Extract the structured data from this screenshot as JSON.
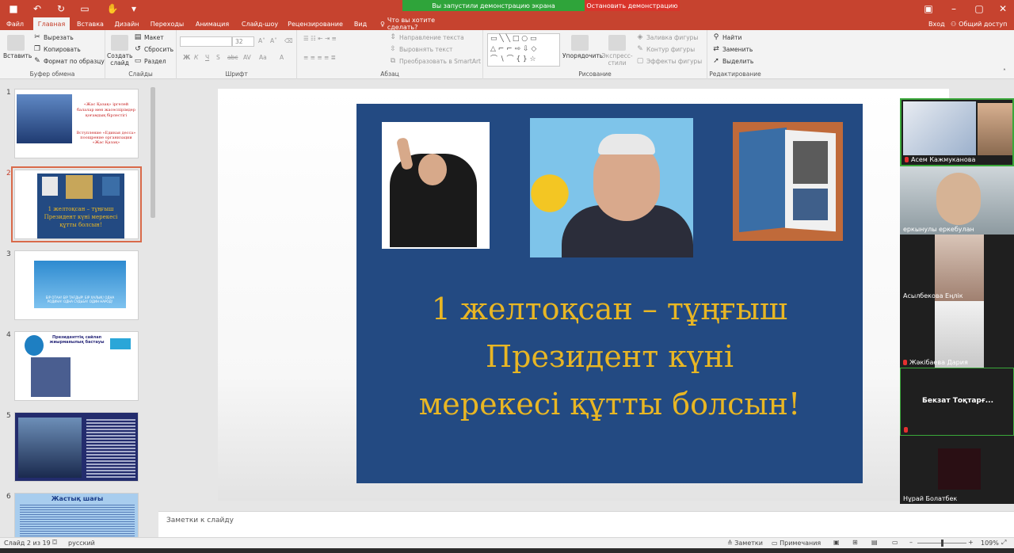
{
  "titlebar": {
    "sharing_text": "Вы запустили демонстрацию экрана",
    "stop_text": "Остановить демонстрацию"
  },
  "tabs": [
    {
      "label": "Файл"
    },
    {
      "label": "Главная"
    },
    {
      "label": "Вставка"
    },
    {
      "label": "Дизайн"
    },
    {
      "label": "Переходы"
    },
    {
      "label": "Анимация"
    },
    {
      "label": "Слайд-шоу"
    },
    {
      "label": "Рецензирование"
    },
    {
      "label": "Вид"
    },
    {
      "label": "Что вы хотите сделать?"
    }
  ],
  "account": {
    "login": "Вход",
    "share": "Общий доступ"
  },
  "ribbon": {
    "clipboard": {
      "paste": "Вставить",
      "cut": "Вырезать",
      "copy": "Копировать",
      "format_painter": "Формат по образцу",
      "label": "Буфер обмена"
    },
    "slides": {
      "new_slide": "Создать слайд",
      "layout": "Макет",
      "reset": "Сбросить",
      "section": "Раздел",
      "label": "Слайды"
    },
    "font": {
      "font_name": "",
      "font_size": "32",
      "label": "Шрифт",
      "bold": "Ж",
      "italic": "К",
      "underline": "Ч",
      "shadow": "S",
      "strike": "abc",
      "spacing": "AV",
      "case": "Aa",
      "color": "A"
    },
    "paragraph": {
      "direction": "Направление текста",
      "align": "Выровнять текст",
      "smartart": "Преобразовать в SmartArt",
      "label": "Абзац"
    },
    "drawing": {
      "arrange": "Упорядочить",
      "quick_styles": "Экспресс-стили",
      "fill": "Заливка фигуры",
      "outline": "Контур фигуры",
      "effects": "Эффекты фигуры",
      "label": "Рисование"
    },
    "editing": {
      "find": "Найти",
      "replace": "Заменить",
      "select": "Выделить",
      "label": "Редактирование"
    }
  },
  "thumbnails": [
    {
      "num": "1",
      "text": "«Жас Қазақ» іргелей балалар мен жасөспірімдер қоғамдық бірлестігі",
      "text2": "Вступление «Единая десса» поощрение организации «Жас Қазақ»"
    },
    {
      "num": "2",
      "text": "1 желтоқсан – тұңғыш Президент күні мерекесі құтты болсын!"
    },
    {
      "num": "3",
      "text": "БІР ОТАН! БІР ТАҒДЫР! БІР ХАЛЫҚ! ОДНА РОДИНА! ОДНА СУДЬБА! ОДИН НАРОД!"
    },
    {
      "num": "4",
      "text": "Президенттің сайлап жиырмаяылық бастауы"
    },
    {
      "num": "5",
      "text": ""
    },
    {
      "num": "6",
      "text": "Жастық шағы"
    }
  ],
  "slide": {
    "line1": "1 желтоқсан – тұңғыш",
    "line2": "Президент күні",
    "line3": "мерекесі құтты болсын!"
  },
  "notes_placeholder": "Заметки к слайду",
  "status": {
    "slide_count": "Слайд 2 из 19",
    "language": "русский",
    "notes": "Заметки",
    "comments": "Примечания",
    "zoom": "109%"
  },
  "participants": [
    {
      "name": "Асем Кажмуканова"
    },
    {
      "name": "еркынулы еркебулан"
    },
    {
      "name": "Асылбекова Еңлік"
    },
    {
      "name": "Жәкібаева Дария"
    },
    {
      "name": "Бекзат Тоқтарғ..."
    },
    {
      "name": "Нұрай Болатбек"
    }
  ],
  "colors": {
    "accent": "#c6432f",
    "slide_bg": "#234a82",
    "slide_text": "#e8b624",
    "share_green": "#2fa43a",
    "share_red": "#d9342b"
  }
}
